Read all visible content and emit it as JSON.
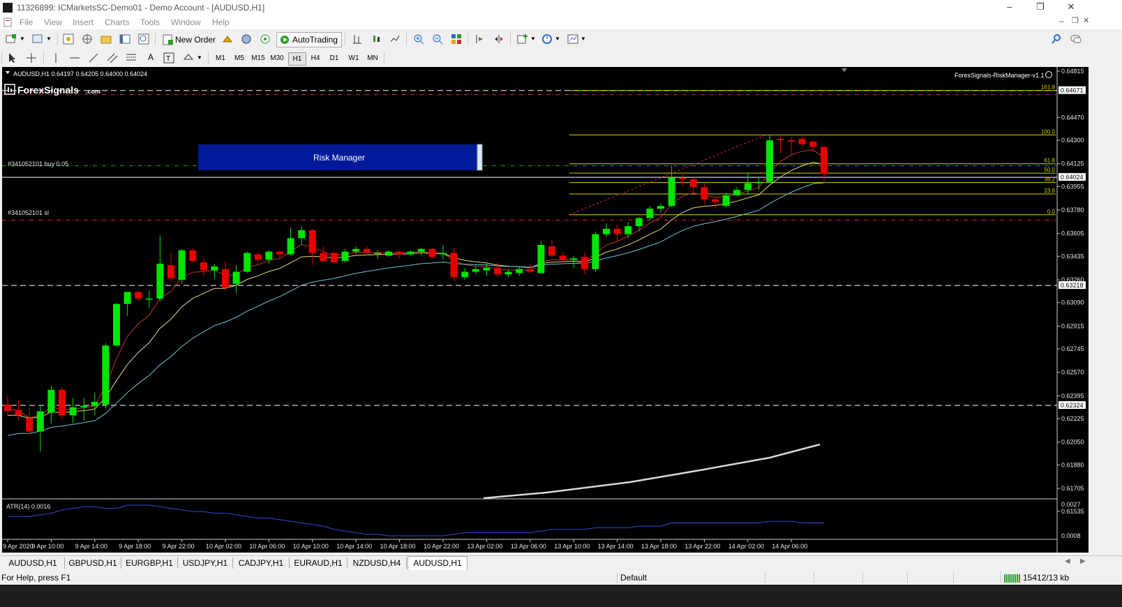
{
  "window": {
    "title": "11326899: ICMarketsSC-Demo01 - Demo Account - [AUDUSD,H1]"
  },
  "menu": [
    "File",
    "View",
    "Insert",
    "Charts",
    "Tools",
    "Window",
    "Help"
  ],
  "toolbar": {
    "new_order": "New Order",
    "autotrading": "AutoTrading"
  },
  "timeframes": [
    "M1",
    "M5",
    "M15",
    "M30",
    "H1",
    "H4",
    "D1",
    "W1",
    "MN"
  ],
  "selected_timeframe": "H1",
  "chart": {
    "header": "AUDUSD,H1  0.64197 0.64205 0.64000 0.64024",
    "logo": "ForexSignals",
    "logo_suffix": ".com",
    "ea_name": "ForexSignals-RiskManager-v1.1",
    "risk_manager_label": "Risk Manager",
    "order_label": "#341052101 buy 0.05",
    "sl_label": "#341052101 sl",
    "fib_levels": [
      "161.8",
      "100.0",
      "61.8",
      "50.0",
      "38.2",
      "23.6",
      "0.0"
    ],
    "price_ticks": [
      "0.64815",
      "0.64470",
      "0.64300",
      "0.64125",
      "0.63955",
      "0.63780",
      "0.63605",
      "0.63435",
      "0.63260",
      "0.63090",
      "0.62915",
      "0.62745",
      "0.62570",
      "0.62395",
      "0.62225",
      "0.62050",
      "0.61880",
      "0.61705",
      "0.61535"
    ],
    "price_boxes": [
      "0.64671",
      "0.64024",
      "0.63218",
      "0.62324"
    ],
    "time_ticks": [
      "9 Apr 2020",
      "9 Apr 10:00",
      "9 Apr 14:00",
      "9 Apr 18:00",
      "9 Apr 22:00",
      "10 Apr 02:00",
      "10 Apr 06:00",
      "10 Apr 10:00",
      "10 Apr 14:00",
      "10 Apr 18:00",
      "10 Apr 22:00",
      "13 Apr 02:00",
      "13 Apr 06:00",
      "13 Apr 10:00",
      "13 Apr 14:00",
      "13 Apr 18:00",
      "13 Apr 22:00",
      "14 Apr 02:00",
      "14 Apr 06:00"
    ],
    "atr_label": "ATR(14) 0.0016",
    "atr_ticks": [
      "0.0027",
      "0.0008"
    ],
    "colors": {
      "bull": "#00e600",
      "bear": "#e60000",
      "fib": "#d4d400",
      "ma_fast": "#c0392b",
      "ma_mid": "#e6d97a",
      "ma_slow": "#6fc3d6",
      "atr": "#2d4ed8",
      "risk_box": "#001a99"
    }
  },
  "tabs": [
    "AUDUSD,H1",
    "GBPUSD,H1",
    "EURGBP,H1",
    "USDJPY,H1",
    "CADJPY,H1",
    "EURAUD,H1",
    "NZDUSD,H4",
    "AUDUSD,H1"
  ],
  "active_tab": 7,
  "status": {
    "help": "For Help, press F1",
    "profile": "Default",
    "traffic": "15412/13 kb"
  }
}
